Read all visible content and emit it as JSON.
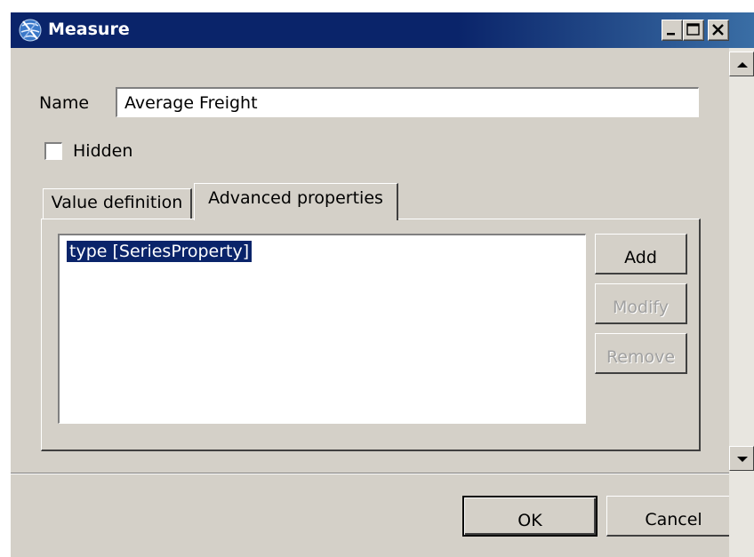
{
  "window": {
    "title": "Measure",
    "icon": "app-globe-icon",
    "controls": [
      "minimize-icon",
      "maximize-icon",
      "close-icon"
    ]
  },
  "form": {
    "name_label": "Name",
    "name_value": "Average Freight",
    "hidden_label": "Hidden",
    "hidden_checked": false
  },
  "tabs": [
    {
      "label": "Value definition",
      "active": false
    },
    {
      "label": "Advanced properties",
      "active": true
    }
  ],
  "properties": {
    "items": [
      "type [SeriesProperty]"
    ],
    "selected_index": 0,
    "buttons": {
      "add": "Add",
      "modify": "Modify",
      "remove": "Remove"
    }
  },
  "footer": {
    "ok": "OK",
    "cancel": "Cancel"
  },
  "colors": {
    "titlebar": "#0a246a",
    "face": "#d4d0c8",
    "selection": "#0a246a"
  }
}
